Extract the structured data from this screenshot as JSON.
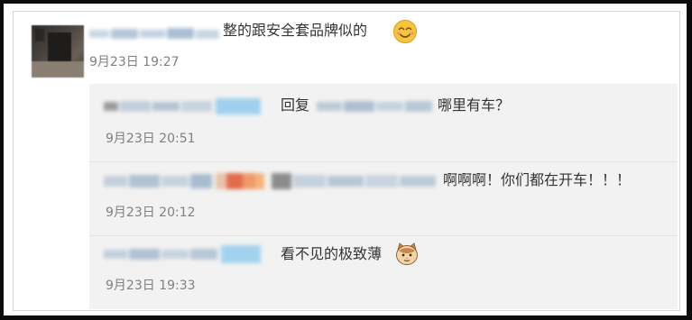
{
  "main_comment": {
    "text": "整的跟安全套品牌似的",
    "emoji": "smiling-face-emoji",
    "timestamp": "9月23日 19:27"
  },
  "replies": [
    {
      "reply_word": "回复",
      "text": "哪里有车？",
      "timestamp": "9月23日 20:51"
    },
    {
      "text": "啊啊啊！你们都在开车！！！",
      "timestamp": "9月23日 20:12"
    },
    {
      "text": "看不见的极致薄",
      "emoji": "cat-face-emoji",
      "timestamp": "9月23日 19:33"
    }
  ],
  "colors": {
    "timestamp": "#808080",
    "reply_bg": "#f2f2f2",
    "blurred_name": "#b9c8d8"
  }
}
